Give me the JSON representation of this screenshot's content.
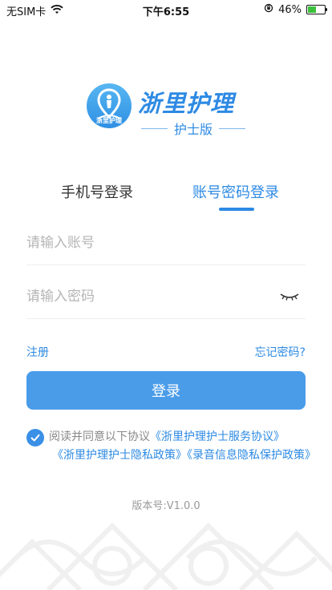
{
  "status_bar": {
    "carrier": "无SIM卡",
    "time": "下午6:55",
    "battery_percent": "46%",
    "battery_level": 0.46,
    "icons": [
      "wifi-icon",
      "orientation-lock-icon",
      "battery-icon"
    ]
  },
  "logo": {
    "title": "浙里护理",
    "subtitle": "护士版",
    "badge_text": "浙里护理"
  },
  "tabs": [
    {
      "label": "手机号登录",
      "active": false
    },
    {
      "label": "账号密码登录",
      "active": true
    }
  ],
  "form": {
    "account_placeholder": "请输入账号",
    "password_placeholder": "请输入密码",
    "register_label": "注册",
    "forgot_label": "忘记密码?",
    "login_label": "登录"
  },
  "agreement": {
    "checked": true,
    "prefix": "阅读并同意以下协议",
    "service_link": "《浙里护理护士服务协议》",
    "privacy_link": "《浙里护理护士隐私政策》",
    "recording_link": "《录音信息隐私保护政策》"
  },
  "version": "版本号:V1.0.0",
  "colors": {
    "brand": "#2d8ae3",
    "button": "#4a9ce9",
    "placeholder": "#b5b5b5"
  }
}
